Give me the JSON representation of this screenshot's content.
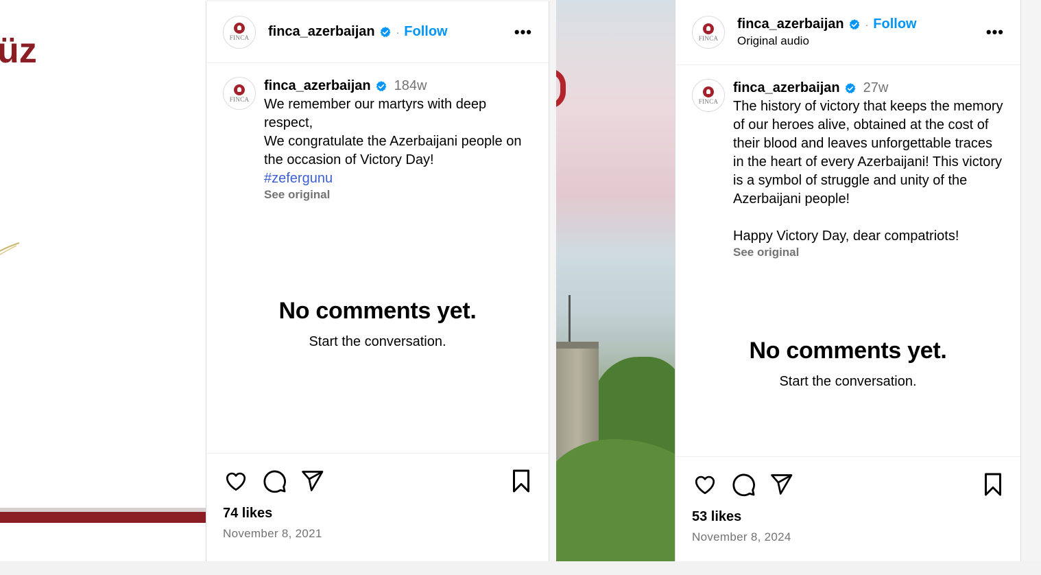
{
  "left_media": {
    "partial_text": "üz"
  },
  "posts": [
    {
      "header": {
        "username": "finca_azerbaijan",
        "dot": "·",
        "follow_label": "Follow",
        "subtitle": "",
        "more_label": "•••"
      },
      "avatar_word": "FINCA",
      "caption": {
        "username": "finca_azerbaijan",
        "time": "184w",
        "paragraphs": [
          "We remember our martyrs with deep respect,",
          "We congratulate the Azerbaijani people on the occasion of Victory Day!"
        ],
        "hashtag": "#zefergunu",
        "see_original": "See original"
      },
      "empty_state": {
        "title": "No comments yet.",
        "subtitle": "Start the conversation."
      },
      "likes": "74 likes",
      "date": "November 8, 2021"
    },
    {
      "header": {
        "username": "finca_azerbaijan",
        "dot": "·",
        "follow_label": "Follow",
        "subtitle": "Original audio",
        "more_label": "•••"
      },
      "avatar_word": "FINCA",
      "caption": {
        "username": "finca_azerbaijan",
        "time": "27w",
        "paragraphs": [
          "The history of victory that keeps the memory of our heroes alive, obtained at the cost of their blood and leaves unforgettable traces in the heart of every Azerbaijani! This victory is a symbol of struggle and unity of the Azerbaijani people!",
          "Happy Victory Day, dear compatriots!"
        ],
        "see_original": "See original"
      },
      "empty_state": {
        "title": "No comments yet.",
        "subtitle": "Start the conversation."
      },
      "likes": "53 likes",
      "date": "November 8, 2024"
    }
  ],
  "icons": {
    "verified": "verified-badge-icon",
    "like": "heart-icon",
    "comment": "comment-icon",
    "share": "share-icon",
    "save": "bookmark-icon",
    "more": "more-options-icon"
  },
  "colors": {
    "follow": "#0095f6",
    "verified": "#0095f6",
    "hashtag": "#3d5ed6",
    "brand_red": "#a3212a",
    "muted": "#737373"
  }
}
